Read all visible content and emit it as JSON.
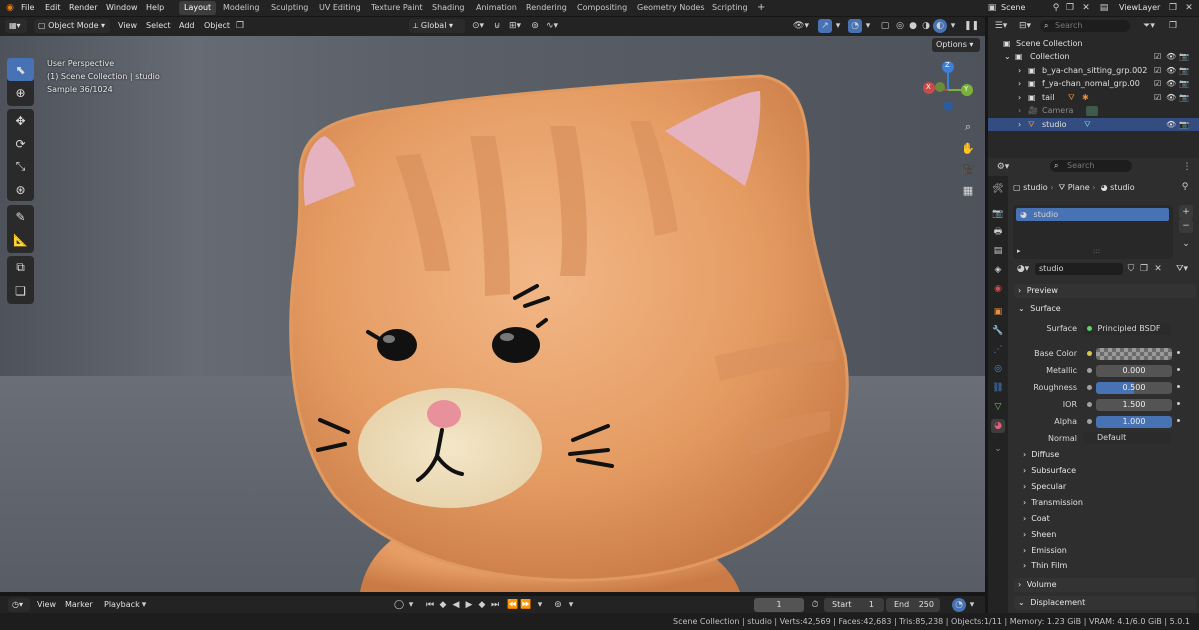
{
  "topbar": {
    "menus": [
      "File",
      "Edit",
      "Render",
      "Window",
      "Help"
    ],
    "workspaces": [
      "Layout",
      "Modeling",
      "Sculpting",
      "UV Editing",
      "Texture Paint",
      "Shading",
      "Animation",
      "Rendering",
      "Compositing",
      "Geometry Nodes",
      "Scripting"
    ],
    "add_tab": "+",
    "scene": "Scene",
    "view_layer": "ViewLayer"
  },
  "viewport_header": {
    "mode": "Object Mode",
    "menus": [
      "View",
      "Select",
      "Add",
      "Object"
    ],
    "transform": "Global",
    "options": "Options"
  },
  "overlay": {
    "perspective": "User Perspective",
    "collection": "(1) Scene Collection | studio",
    "sample": "Sample 36/1024"
  },
  "gizmo": {
    "x": "X",
    "y": "Y",
    "z": "Z"
  },
  "outliner": {
    "search_placeholder": "Search",
    "rows": [
      {
        "label": "Scene Collection"
      },
      {
        "label": "Collection"
      },
      {
        "label": "b_ya-chan_sitting_grp.002"
      },
      {
        "label": "f_ya-chan_nomal_grp.00"
      },
      {
        "label": "tail"
      },
      {
        "label": "Camera"
      },
      {
        "label": "studio"
      }
    ]
  },
  "properties": {
    "search_placeholder": "Search",
    "breadcrumb": [
      "studio",
      "Plane",
      "studio"
    ],
    "slot": "studio",
    "material_name": "studio",
    "sections": {
      "preview": "Preview",
      "surface": "Surface"
    },
    "surface_label": "Surface",
    "surface_value": "Principled BSDF",
    "fields": [
      {
        "label": "Base Color",
        "value": ""
      },
      {
        "label": "Metallic",
        "value": "0.000"
      },
      {
        "label": "Roughness",
        "value": "0.500"
      },
      {
        "label": "IOR",
        "value": "1.500"
      },
      {
        "label": "Alpha",
        "value": "1.000"
      },
      {
        "label": "Normal",
        "value": "Default"
      }
    ],
    "subsections": [
      "Diffuse",
      "Subsurface",
      "Specular",
      "Transmission",
      "Coat",
      "Sheen",
      "Emission",
      "Thin Film"
    ],
    "volume": "Volume",
    "displacement": "Displacement"
  },
  "timeline": {
    "menus": [
      "View",
      "Marker",
      "Playback"
    ],
    "current_frame": "1",
    "start_label": "Start",
    "start": "1",
    "end_label": "End",
    "end": "250"
  },
  "status": {
    "text": "Scene Collection | studio | Verts:42,569 | Faces:42,683 | Tris:85,238 | Objects:1/11 | Memory: 1.23 GiB | VRAM: 4.1/6.0 GiB | 5.0.1"
  },
  "colors": {
    "accent": "#4772b3",
    "selection": "#334d80",
    "fur": "#e7a36d"
  }
}
